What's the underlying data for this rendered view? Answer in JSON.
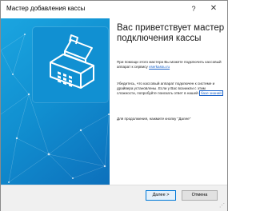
{
  "window": {
    "title": "Мастер добавления кассы",
    "help_glyph": "?",
    "close_glyph": "✕"
  },
  "hero": {
    "icon": "cash-register-icon",
    "accent": "#1294d6"
  },
  "panel": {
    "heading": "Вас приветствует мастер подключения кассы",
    "intro_text": "При помощи этого мастера Вы можете подключить кассовый аппарат к сервису ",
    "service_link": "vserkassu.ru",
    "check_text": "Убедитесь, что кассовый аппарат подключен к системе и драйвера установлены. Если у Вас возникли с этим сложности, попробуйте поискать ответ в нашей ",
    "kb_link": "базе знаний",
    "continue_text": "Для продолжения, нажмите кнопку \"Далее\""
  },
  "footer": {
    "next_label": "Далее >",
    "cancel_label": "Отмена"
  }
}
